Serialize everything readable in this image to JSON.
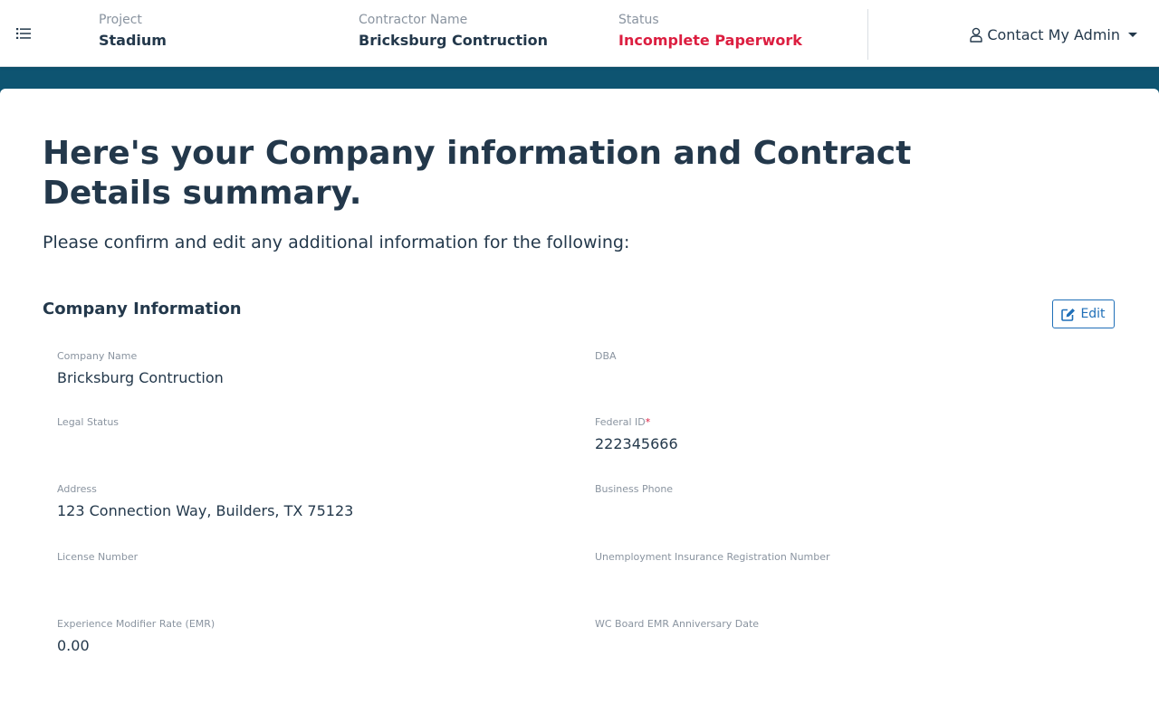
{
  "header": {
    "menu_icon": "list-icon",
    "project": {
      "label": "Project",
      "value": "Stadium"
    },
    "contractor": {
      "label": "Contractor Name",
      "value": "Bricksburg Contruction"
    },
    "status": {
      "label": "Status",
      "value": "Incomplete Paperwork",
      "color": "#dc1e40"
    },
    "admin_menu": {
      "icon": "user-icon",
      "label": "Contact My Admin",
      "caret_icon": "caret-down-icon"
    }
  },
  "colors": {
    "band": "#0e5471",
    "heading": "#23384b",
    "label": "#8a94a0",
    "accent": "#1f6fb8",
    "required": "#dc1e40"
  },
  "page": {
    "title": "Here's your Company information and Contract Details summary.",
    "subtitle": "Please confirm and edit any additional information for the following:"
  },
  "company_info": {
    "section_title": "Company Information",
    "edit_button": {
      "icon": "edit-icon",
      "label": "Edit"
    },
    "fields": {
      "company_name": {
        "label": "Company Name",
        "value": "Bricksburg Contruction"
      },
      "dba": {
        "label": "DBA",
        "value": ""
      },
      "legal_status": {
        "label": "Legal Status",
        "value": ""
      },
      "federal_id": {
        "label": "Federal ID",
        "required_mark": "*",
        "value": "222345666"
      },
      "address": {
        "label": "Address",
        "value": "123 Connection Way, Builders, TX 75123"
      },
      "business_phone": {
        "label": "Business Phone",
        "value": ""
      },
      "license_number": {
        "label": "License Number",
        "value": ""
      },
      "unemployment_insurance": {
        "label": "Unemployment Insurance Registration Number",
        "value": ""
      },
      "emr": {
        "label": "Experience Modifier Rate (EMR)",
        "value": "0.00"
      },
      "wc_board_emr_date": {
        "label": "WC Board EMR Anniversary Date",
        "value": ""
      }
    }
  }
}
